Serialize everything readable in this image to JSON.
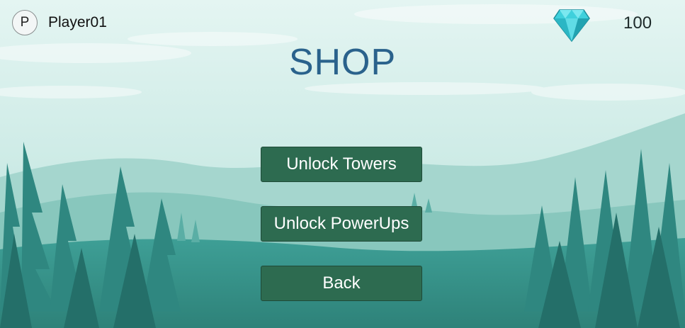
{
  "player": {
    "avatar_letter": "P",
    "name": "Player01"
  },
  "currency": {
    "icon": "diamond-icon",
    "amount": "100"
  },
  "title": "SHOP",
  "buttons": {
    "unlock_towers": "Unlock Towers",
    "unlock_powerups": "Unlock PowerUps",
    "back": "Back"
  },
  "colors": {
    "sky": "#d7efeb",
    "button_bg": "#2d6b50",
    "title": "#2a628c",
    "gem": "#3fd0dc"
  }
}
